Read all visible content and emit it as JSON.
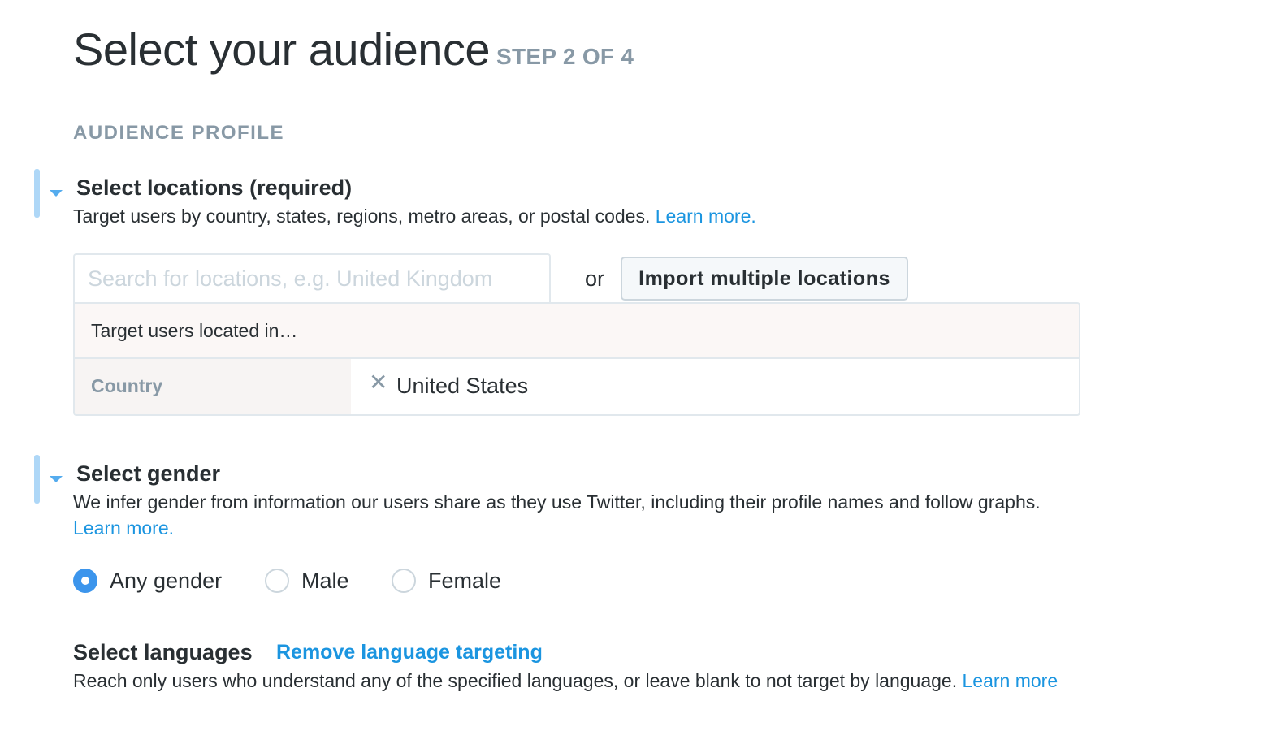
{
  "header": {
    "title": "Select your audience",
    "step": "STEP 2 OF 4"
  },
  "section": {
    "label": "AUDIENCE PROFILE"
  },
  "locations": {
    "title": "Select locations (required)",
    "description": "Target users by country, states, regions, metro areas, or postal codes.",
    "learn_more": "Learn more.",
    "search_placeholder": "Search for locations, e.g. United Kingdom",
    "search_value": "",
    "or_text": "or",
    "import_button": "Import multiple locations",
    "panel_header": "Target users located in…",
    "rows": [
      {
        "label": "Country",
        "value": "United States"
      }
    ]
  },
  "gender": {
    "title": "Select gender",
    "description": "We infer gender from information our users share as they use Twitter, including their profile names and follow graphs.",
    "learn_more": "Learn more.",
    "options": [
      {
        "label": "Any gender",
        "selected": true
      },
      {
        "label": "Male",
        "selected": false
      },
      {
        "label": "Female",
        "selected": false
      }
    ]
  },
  "languages": {
    "title": "Select languages",
    "remove_link": "Remove language targeting",
    "description": "Reach only users who understand any of the specified languages, or leave blank to not target by language.",
    "learn_more": "Learn more"
  },
  "icons": {
    "caret": "caret-down-icon",
    "remove": "close-x-icon"
  },
  "colors": {
    "accent_blue": "#1b95e0",
    "accent_bar": "#aed7f7",
    "muted_gray": "#8899a6",
    "radio_selected": "#3c95ec"
  }
}
